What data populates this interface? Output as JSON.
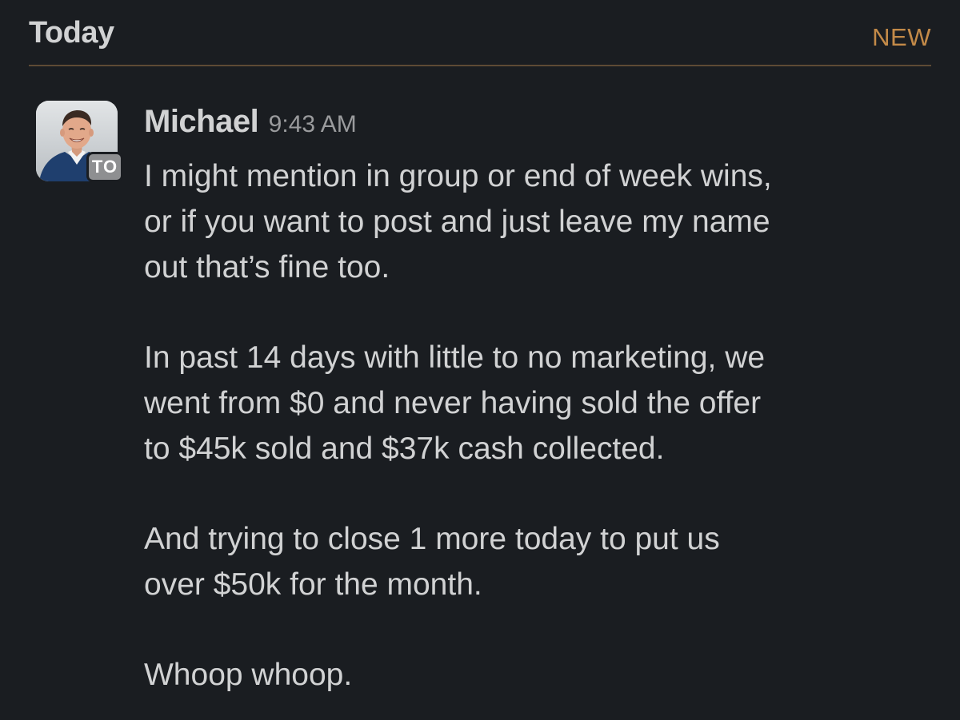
{
  "divider": {
    "day_label": "Today",
    "new_label": "NEW"
  },
  "message": {
    "author": "Michael",
    "timestamp": "9:43 AM",
    "status_badge": "TO",
    "avatar_icon": "profile-photo",
    "paragraphs": [
      "I might mention in group or end of week wins,\nor if you want to post and just leave my name\nout that’s fine too.",
      "In past 14 days with little to no marketing, we\nwent from $0 and never having sold the offer\nto $45k sold and $37k cash collected.",
      "And trying to close 1 more today to put us\nover $50k for the month.",
      "Whoop whoop."
    ]
  },
  "colors": {
    "background": "#1a1d21",
    "text": "#d1d2d3",
    "new_accent": "#c38a48",
    "timestamp": "#9a9b9d"
  }
}
